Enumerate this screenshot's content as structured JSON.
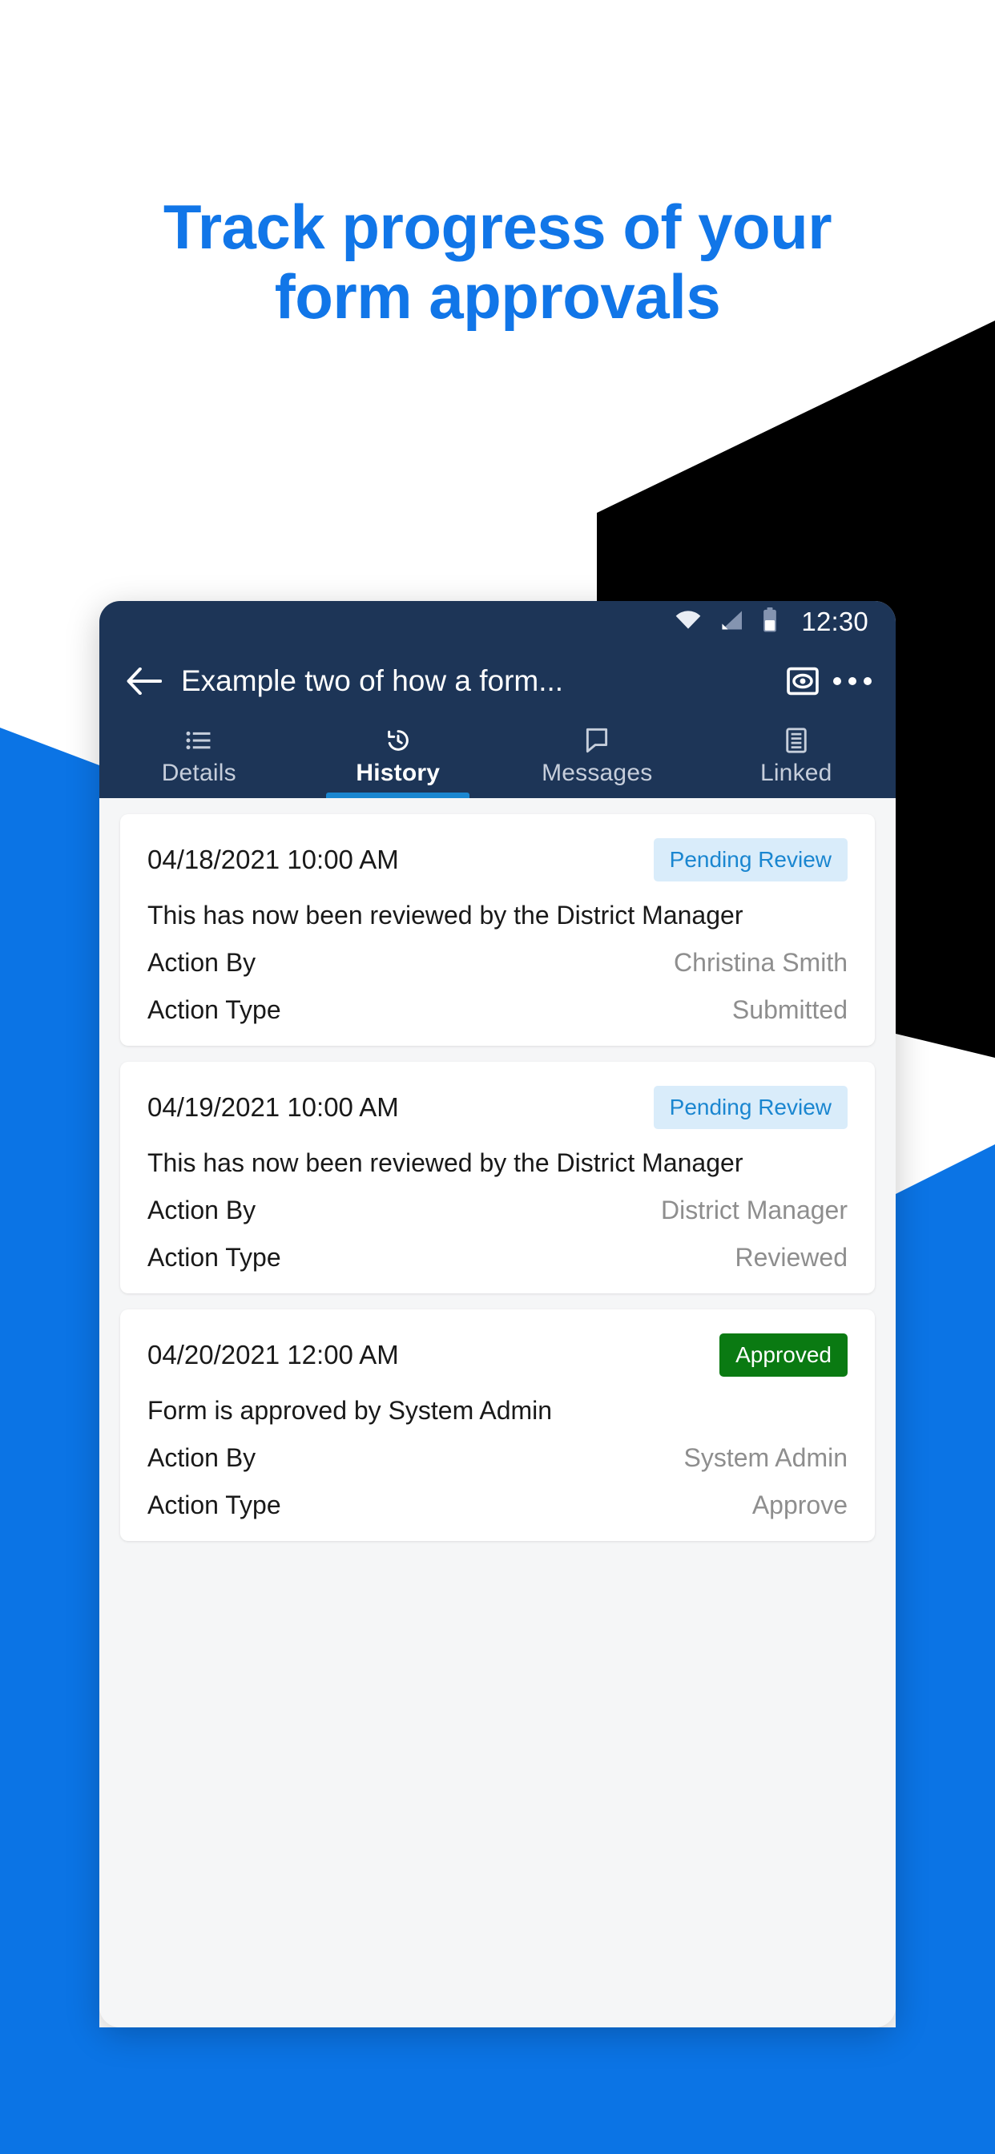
{
  "theme": {
    "brand_blue": "#0B74E5",
    "headline_blue": "#1176e8",
    "navy": "#1d3557",
    "tab_accent": "#1a86d0",
    "badge_pending_bg": "#d9ecfa",
    "badge_pending_text": "#1a86d0",
    "badge_approved_bg": "#0a7a12",
    "black_shape": "#000000",
    "screen_bg": "#f5f6f7",
    "card_bg": "#ffffff"
  },
  "headline": {
    "line1": "Track progress of your",
    "line2": "form approvals"
  },
  "phone": {
    "statusbar": {
      "time": "12:30",
      "icons": [
        "wifi-icon",
        "cellular-signal-icon",
        "battery-icon"
      ]
    },
    "appbar": {
      "back_icon": "arrow-back-icon",
      "title": "Example two of how a form...",
      "preview_icon": "eye-preview-icon",
      "overflow_icon": "overflow-menu-icon"
    },
    "tabs": [
      {
        "label": "Details",
        "icon": "list-icon",
        "active": false
      },
      {
        "label": "History",
        "icon": "history-icon",
        "active": true
      },
      {
        "label": "Messages",
        "icon": "chat-bubble-icon",
        "active": false
      },
      {
        "label": "Linked",
        "icon": "document-icon",
        "active": false
      }
    ],
    "history_cards": [
      {
        "date": "04/18/2021 10:00 AM",
        "badge": "Pending Review",
        "badge_type": "pending",
        "description": "This has now been reviewed by the District Manager",
        "rows": [
          {
            "label": "Action By",
            "value": "Christina Smith"
          },
          {
            "label": "Action Type",
            "value": "Submitted"
          }
        ]
      },
      {
        "date": "04/19/2021 10:00 AM",
        "badge": "Pending Review",
        "badge_type": "pending",
        "description": "This has now been reviewed by the District Manager",
        "rows": [
          {
            "label": "Action By",
            "value": "District Manager"
          },
          {
            "label": "Action Type",
            "value": "Reviewed"
          }
        ]
      },
      {
        "date": "04/20/2021 12:00 AM",
        "badge": "Approved",
        "badge_type": "approved",
        "description": "Form is approved by System Admin",
        "rows": [
          {
            "label": "Action By",
            "value": "System Admin"
          },
          {
            "label": "Action Type",
            "value": "Approve"
          }
        ]
      }
    ]
  }
}
